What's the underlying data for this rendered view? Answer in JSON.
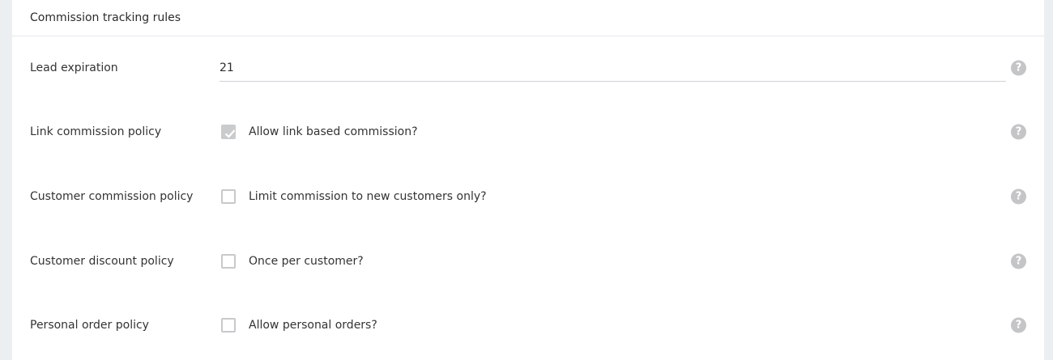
{
  "section": {
    "title": "Commission tracking rules"
  },
  "lead_expiration": {
    "label": "Lead expiration",
    "value": "21"
  },
  "rules": [
    {
      "label": "Link commission policy",
      "checkbox_label": "Allow link based commission?",
      "checked": true
    },
    {
      "label": "Customer commission policy",
      "checkbox_label": "Limit commission to new customers only?",
      "checked": false
    },
    {
      "label": "Customer discount policy",
      "checkbox_label": "Once per customer?",
      "checked": false
    },
    {
      "label": "Personal order policy",
      "checkbox_label": "Allow personal orders?",
      "checked": false
    }
  ],
  "help_icon": {
    "glyph": "?",
    "icon": "help-circle-icon"
  }
}
